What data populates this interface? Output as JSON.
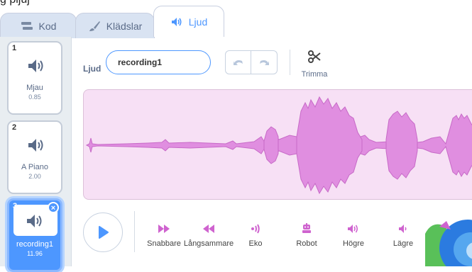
{
  "partial_top_text": "g                    pijuj",
  "tabs": [
    {
      "label": "Kod",
      "icon": "code-blocks-icon",
      "active": false
    },
    {
      "label": "Klädslar",
      "icon": "paintbrush-icon",
      "active": false
    },
    {
      "label": "Ljud",
      "icon": "speaker-icon",
      "active": true
    }
  ],
  "sounds": [
    {
      "number": "1",
      "name": "Mjau",
      "duration": "0.85",
      "selected": false
    },
    {
      "number": "2",
      "name": "A Piano",
      "duration": "2.00",
      "selected": false
    },
    {
      "number": "3",
      "name": "recording1",
      "duration": "11.96",
      "selected": true
    }
  ],
  "editor": {
    "name_label": "Ljud",
    "name_value": "recording1",
    "trim_label": "Trimma"
  },
  "effects": [
    {
      "label": "Snabbare",
      "icon": "faster-icon"
    },
    {
      "label": "Långsammare",
      "icon": "slower-icon"
    },
    {
      "label": "Eko",
      "icon": "echo-icon"
    },
    {
      "label": "Robot",
      "icon": "robot-icon"
    },
    {
      "label": "Högre",
      "icon": "louder-icon"
    },
    {
      "label": "Lägre",
      "icon": "softer-icon"
    }
  ],
  "colors": {
    "accent": "#4d97ff",
    "effect": "#cf63cf",
    "waveform_fill": "#e08ee0",
    "waveform_bg": "#f7e0f5"
  }
}
